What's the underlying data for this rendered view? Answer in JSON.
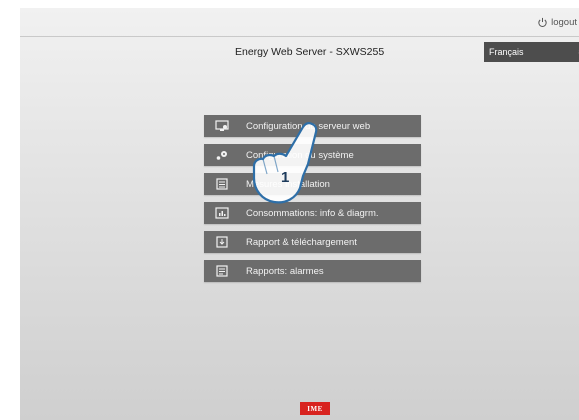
{
  "header": {
    "logout_label": "logout"
  },
  "app": {
    "title": "Energy Web Server - SXWS255"
  },
  "language": {
    "selected": "Français"
  },
  "menu": {
    "items": [
      {
        "label": "Configuration du serveur web",
        "icon": "monitor-config-icon"
      },
      {
        "label": "Configuration du système",
        "icon": "gears-icon"
      },
      {
        "label": "Mesures installation",
        "icon": "list-icon"
      },
      {
        "label": "Consommations: info & diagrm.",
        "icon": "chart-icon"
      },
      {
        "label": "Rapport & téléchargement",
        "icon": "report-download-icon"
      },
      {
        "label": "Rapports: alarmes",
        "icon": "alarm-report-icon"
      }
    ]
  },
  "overlay": {
    "step_number": "1"
  },
  "footer": {
    "brand": "IME"
  },
  "colors": {
    "menu_bg": "#6c6c6c",
    "lang_bg": "#4d4d4d",
    "brand_red": "#d8231f"
  }
}
